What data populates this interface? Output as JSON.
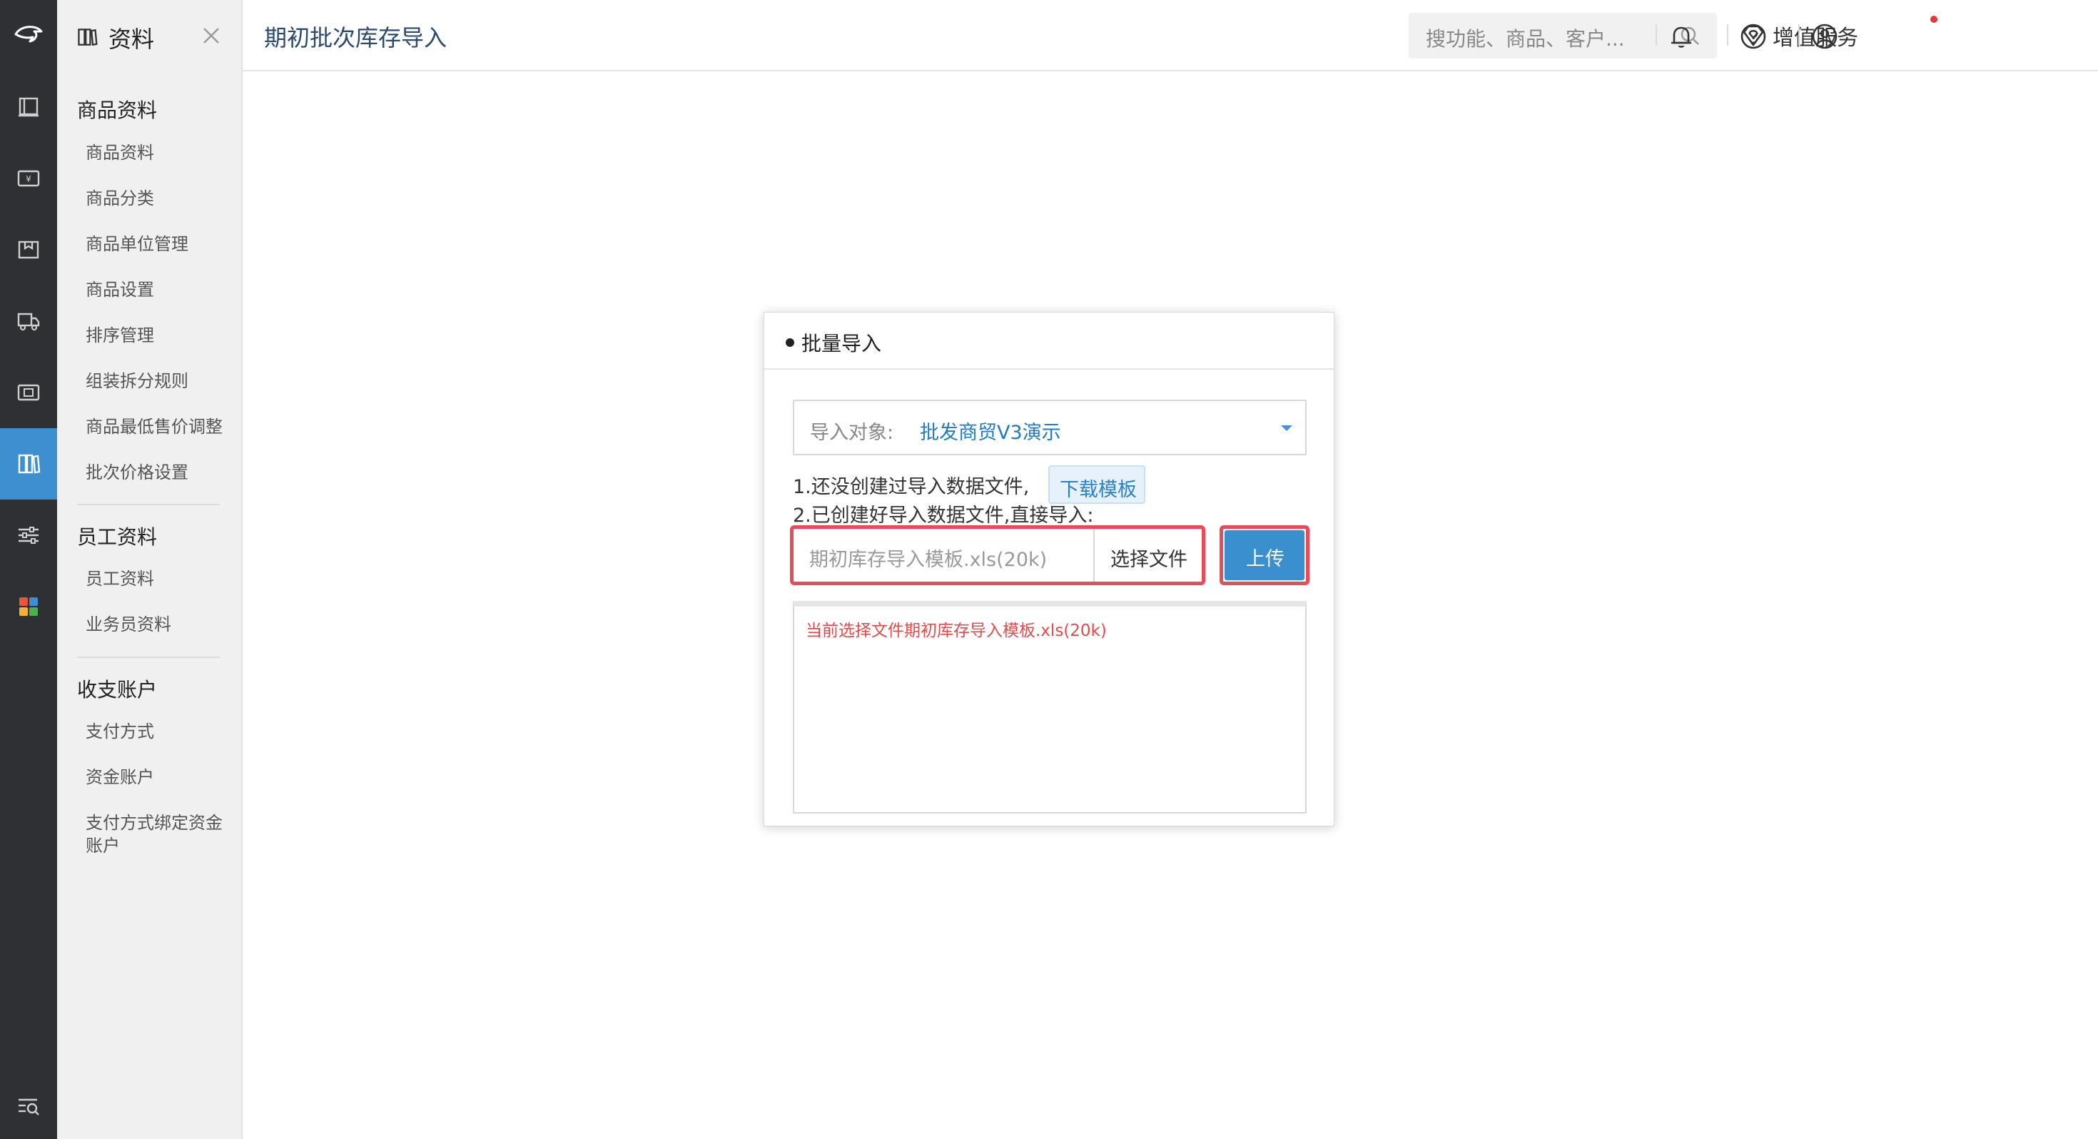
{
  "rail": {
    "items": [
      {
        "icon": "report-icon"
      },
      {
        "icon": "sales-icon"
      },
      {
        "icon": "package-icon"
      },
      {
        "icon": "truck-icon"
      },
      {
        "icon": "ticket-icon"
      },
      {
        "icon": "books-icon",
        "active": true
      },
      {
        "icon": "sliders-icon"
      },
      {
        "icon": "apps-grid-icon"
      }
    ],
    "bottom_icon": "search-list-icon",
    "active_color": "#3e8fd0"
  },
  "sidebar": {
    "title": "资料",
    "groups": [
      {
        "title": "商品资料",
        "items": [
          "商品资料",
          "商品分类",
          "商品单位管理",
          "商品设置",
          "排序管理",
          "组装拆分规则",
          "商品最低售价调整",
          "批次价格设置"
        ]
      },
      {
        "title": "员工资料",
        "items": [
          "员工资料",
          "业务员资料"
        ]
      },
      {
        "title": "收支账户",
        "items": [
          "支付方式",
          "资金账户",
          "支付方式绑定资金账户"
        ]
      }
    ]
  },
  "topbar": {
    "page_title": "期初批次库存导入",
    "search_placeholder": "搜功能、商品、客户...",
    "value_added_label": "增值服务",
    "has_notification": true
  },
  "dialog": {
    "title": "批量导入",
    "target_label": "导入对象:",
    "target_value": "批发商贸V3演示",
    "step1_text": "1.还没创建过导入数据文件,",
    "download_label": "下载模板",
    "step2_text": "2.已创建好导入数据文件,直接导入:",
    "file_name": "期初库存导入模板.xls(20k)",
    "choose_file_label": "选择文件",
    "upload_label": "上传",
    "log_message": "当前选择文件期初库存导入模板.xls(20k)"
  },
  "colors": {
    "primary": "#3a8fcf",
    "highlight_border": "#e84b5b",
    "error_text": "#e34b4b",
    "rail_bg": "#2f3033"
  }
}
